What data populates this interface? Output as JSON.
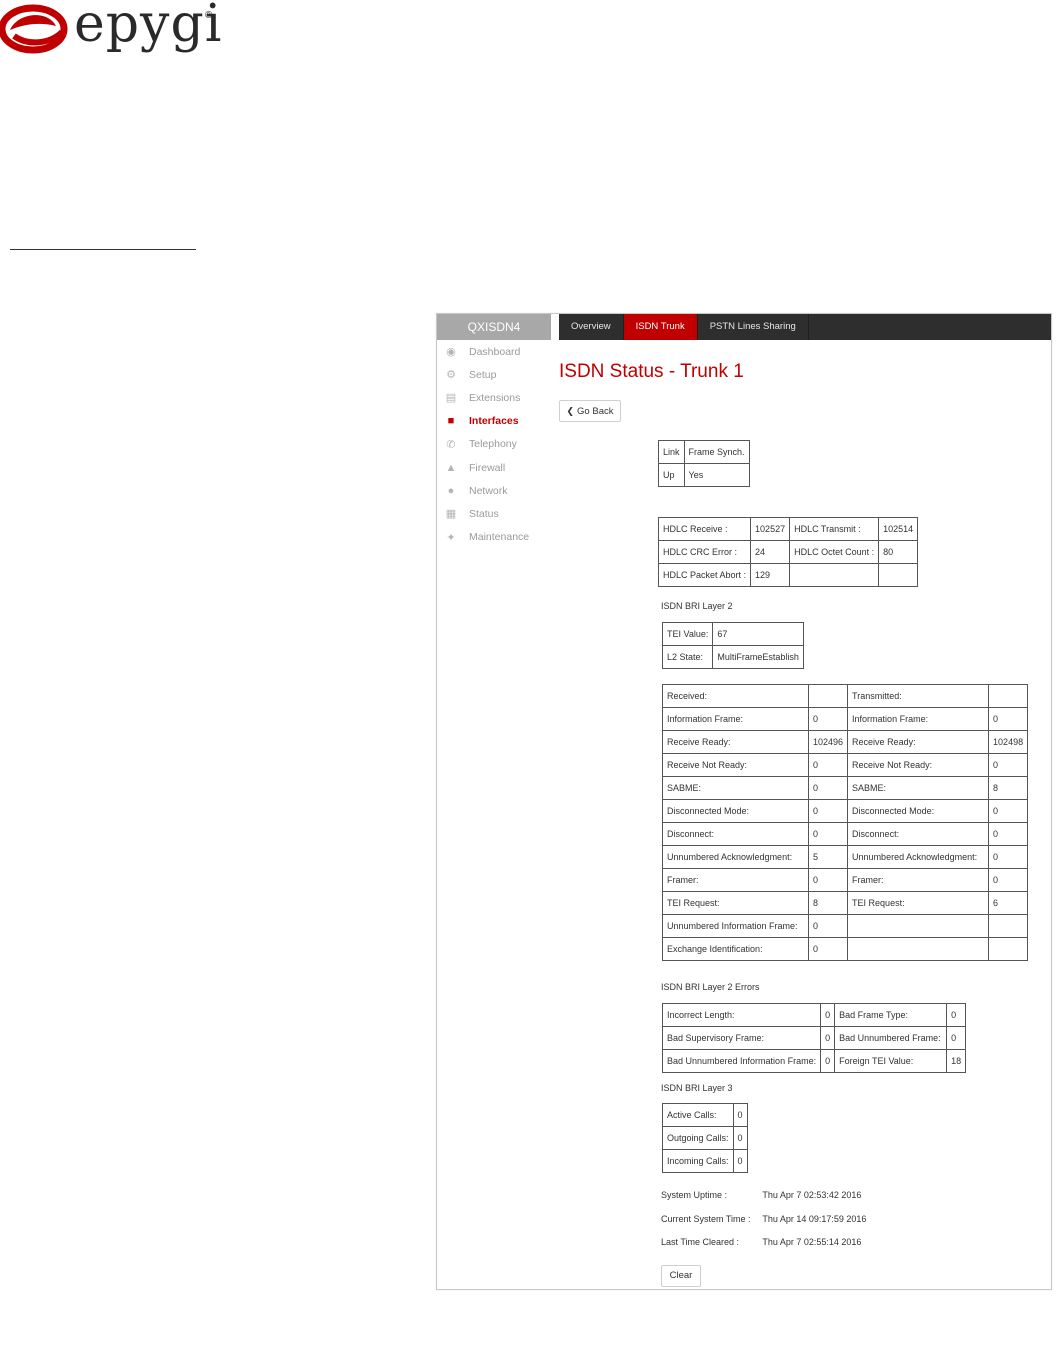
{
  "brand": {
    "name": "epygi",
    "mark": "®",
    "color": "#c00000"
  },
  "app": {
    "device": "QXISDN4",
    "tabs": [
      {
        "label": "Overview",
        "active": false
      },
      {
        "label": "ISDN Trunk",
        "active": true
      },
      {
        "label": "PSTN Lines Sharing",
        "active": false
      }
    ],
    "menu": [
      {
        "label": "Dashboard",
        "icon": "dashboard-icon"
      },
      {
        "label": "Setup",
        "icon": "gear-icon"
      },
      {
        "label": "Extensions",
        "icon": "book-icon"
      },
      {
        "label": "Interfaces",
        "icon": "sitemap-icon",
        "active": true
      },
      {
        "label": "Telephony",
        "icon": "phone-icon"
      },
      {
        "label": "Firewall",
        "icon": "fire-icon"
      },
      {
        "label": "Network",
        "icon": "globe-icon"
      },
      {
        "label": "Status",
        "icon": "chart-icon"
      },
      {
        "label": "Maintenance",
        "icon": "wrench-icon"
      }
    ]
  },
  "page": {
    "title": "ISDN Status - Trunk 1",
    "go_back": "Go Back",
    "link_table": {
      "h1": "Link",
      "h2": "Frame Synch.",
      "v1": "Up",
      "v2": "Yes"
    },
    "hdlc": {
      "receive_label": "HDLC Receive :",
      "receive": "102527",
      "transmit_label": "HDLC Transmit :",
      "transmit": "102514",
      "crc_label": "HDLC CRC Error :",
      "crc": "24",
      "octet_label": "HDLC Octet Count :",
      "octet": "80",
      "abort_label": "HDLC Packet Abort :",
      "abort": "129"
    },
    "layer2_title": "ISDN BRI Layer 2",
    "layer2": {
      "tei_label": "TEI Value:",
      "tei": "67",
      "state_label": "L2 State:",
      "state": "MultiFrameEstablish"
    },
    "frames": {
      "received_header": "Received:",
      "transmitted_header": "Transmitted:",
      "rows": [
        {
          "rl": "Information Frame:",
          "rv": "0",
          "tl": "Information Frame:",
          "tv": "0"
        },
        {
          "rl": "Receive Ready:",
          "rv": "102496",
          "tl": "Receive Ready:",
          "tv": "102498"
        },
        {
          "rl": "Receive Not Ready:",
          "rv": "0",
          "tl": "Receive Not Ready:",
          "tv": "0"
        },
        {
          "rl": "SABME:",
          "rv": "0",
          "tl": "SABME:",
          "tv": "8"
        },
        {
          "rl": "Disconnected Mode:",
          "rv": "0",
          "tl": "Disconnected Mode:",
          "tv": "0"
        },
        {
          "rl": "Disconnect:",
          "rv": "0",
          "tl": "Disconnect:",
          "tv": "0"
        },
        {
          "rl": "Unnumbered Acknowledgment:",
          "rv": "5",
          "tl": "Unnumbered Acknowledgment:",
          "tv": "0"
        },
        {
          "rl": "Framer:",
          "rv": "0",
          "tl": "Framer:",
          "tv": "0"
        },
        {
          "rl": "TEI Request:",
          "rv": "8",
          "tl": "TEI Request:",
          "tv": "6"
        },
        {
          "rl": "Unnumbered Information Frame:",
          "rv": "0",
          "tl": "",
          "tv": ""
        },
        {
          "rl": "Exchange Identification:",
          "rv": "0",
          "tl": "",
          "tv": ""
        }
      ]
    },
    "errors_title": "ISDN BRI Layer 2 Errors",
    "errors": {
      "rows": [
        {
          "l1": "Incorrect Length:",
          "v1": "0",
          "l2": "Bad Frame Type:",
          "v2": "0"
        },
        {
          "l1": "Bad Supervisory Frame:",
          "v1": "0",
          "l2": "Bad Unnumbered Frame:",
          "v2": "0"
        },
        {
          "l1": "Bad Unnumbered Information Frame:",
          "v1": "0",
          "l2": "Foreign TEI Value:",
          "v2": "18"
        }
      ]
    },
    "layer3_title": "ISDN BRI Layer 3",
    "layer3": {
      "rows": [
        {
          "l": "Active Calls:",
          "v": "0"
        },
        {
          "l": "Outgoing Calls:",
          "v": "0"
        },
        {
          "l": "Incoming Calls:",
          "v": "0"
        }
      ]
    },
    "uptime_label": "System Uptime :",
    "uptime": "Thu Apr 7 02:53:42 2016",
    "systime_label": "Current System Time :",
    "systime": "Thu Apr 14 09:17:59 2016",
    "cleared_label": "Last Time Cleared :",
    "cleared": "Thu Apr 7 02:55:14 2016",
    "clear_button": "Clear"
  }
}
